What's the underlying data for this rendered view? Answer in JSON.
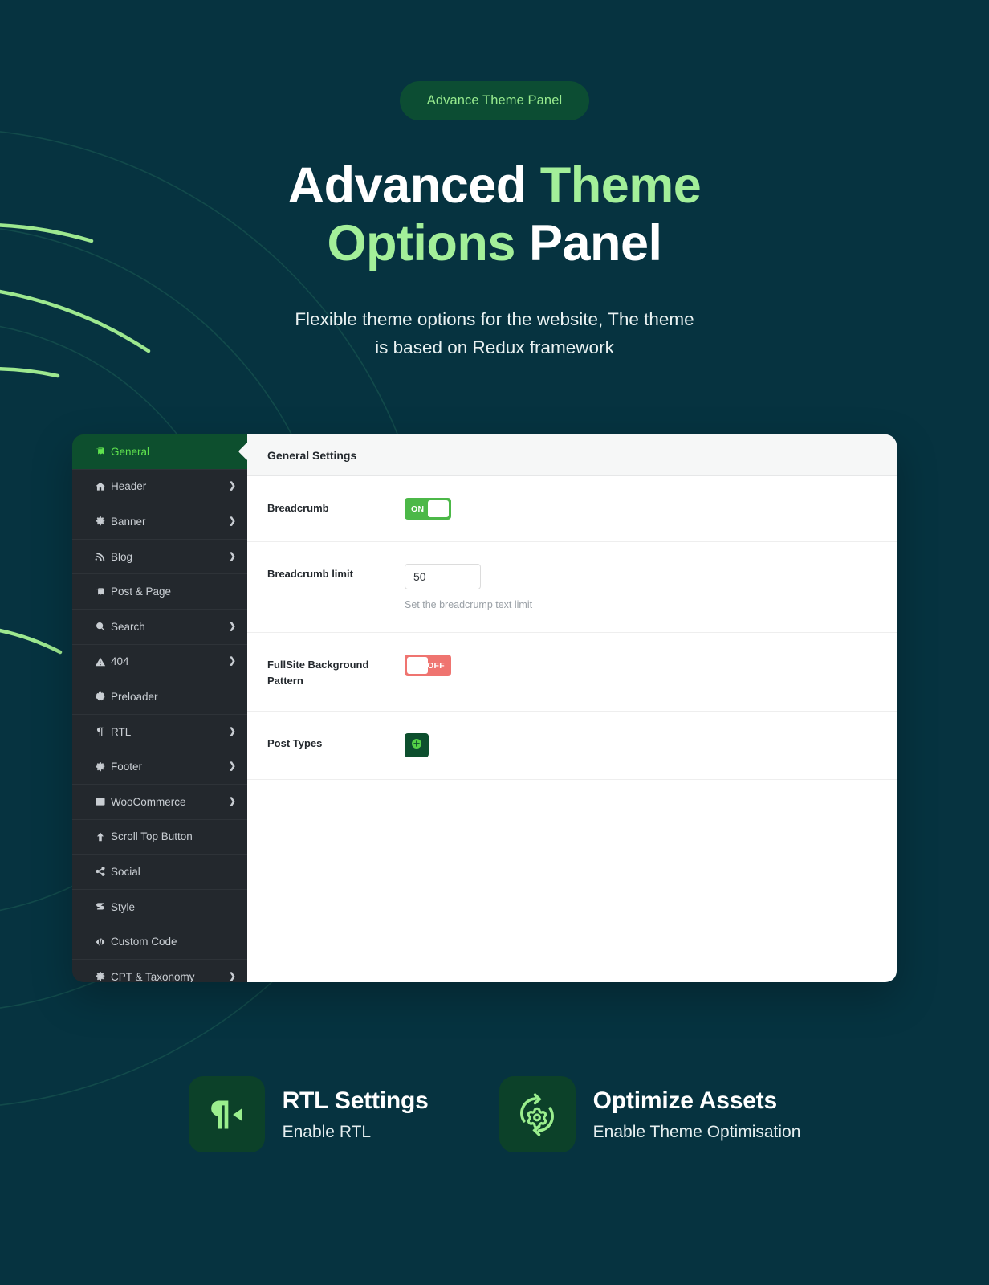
{
  "hero": {
    "badge": "Advance Theme Panel",
    "title_part1": "Advanced ",
    "title_accent1": "Theme",
    "title_accent2": "Options",
    "title_part2": " Panel",
    "subtitle_line1": "Flexible theme options for the website, The theme",
    "subtitle_line2": "is based on Redux framework"
  },
  "colors": {
    "page_bg": "#063340",
    "accent_green": "#a3ef99",
    "badge_bg": "#0c4d33",
    "sidebar_bg": "#23282d",
    "active_item_bg": "#0d4f2e",
    "toggle_on": "#4cb848",
    "toggle_off": "#ef7470"
  },
  "panel": {
    "sidebar": {
      "items": [
        {
          "label": "General",
          "icon": "book-icon",
          "caret": "",
          "active": true
        },
        {
          "label": "Header",
          "icon": "home-icon",
          "caret": "❯",
          "active": false
        },
        {
          "label": "Banner",
          "icon": "gear-icon",
          "caret": "❯",
          "active": false
        },
        {
          "label": "Blog",
          "icon": "rss-icon",
          "caret": "❯",
          "active": false
        },
        {
          "label": "Post & Page",
          "icon": "book-icon",
          "caret": "",
          "active": false
        },
        {
          "label": "Search",
          "icon": "search-icon",
          "caret": "❯",
          "active": false
        },
        {
          "label": "404",
          "icon": "warning-icon",
          "caret": "❯",
          "active": false
        },
        {
          "label": "Preloader",
          "icon": "spinner-icon",
          "caret": "",
          "active": false
        },
        {
          "label": "RTL",
          "icon": "pilcrow-icon",
          "caret": "❯",
          "active": false
        },
        {
          "label": "Footer",
          "icon": "gear-icon",
          "caret": "❯",
          "active": false
        },
        {
          "label": "WooCommerce",
          "icon": "store-icon",
          "caret": "❯",
          "active": false
        },
        {
          "label": "Scroll Top Button",
          "icon": "arrow-up-icon",
          "caret": "",
          "active": false
        },
        {
          "label": "Social",
          "icon": "share-icon",
          "caret": "",
          "active": false
        },
        {
          "label": "Style",
          "icon": "css-icon",
          "caret": "",
          "active": false
        },
        {
          "label": "Custom Code",
          "icon": "code-icon",
          "caret": "",
          "active": false
        },
        {
          "label": "CPT & Taxonomy",
          "icon": "gear-icon",
          "caret": "❯",
          "active": false
        }
      ]
    },
    "content": {
      "heading": "General Settings",
      "fields": [
        {
          "label": "Breadcrumb",
          "type": "toggle",
          "state": "ON",
          "helper": ""
        },
        {
          "label": "Breadcrumb limit",
          "type": "text",
          "value": "50",
          "helper": "Set the breadcrump text limit"
        },
        {
          "label": "FullSite Background Pattern",
          "type": "toggle",
          "state": "OFF",
          "helper": ""
        },
        {
          "label": "Post Types",
          "type": "button",
          "button_icon": "plus-circle-icon",
          "helper": ""
        }
      ]
    }
  },
  "features": [
    {
      "icon": "rtl-pilcrow-icon",
      "title": "RTL Settings",
      "subtitle": "Enable RTL"
    },
    {
      "icon": "optimize-gear-refresh-icon",
      "title": "Optimize Assets",
      "subtitle": "Enable Theme Optimisation"
    }
  ]
}
